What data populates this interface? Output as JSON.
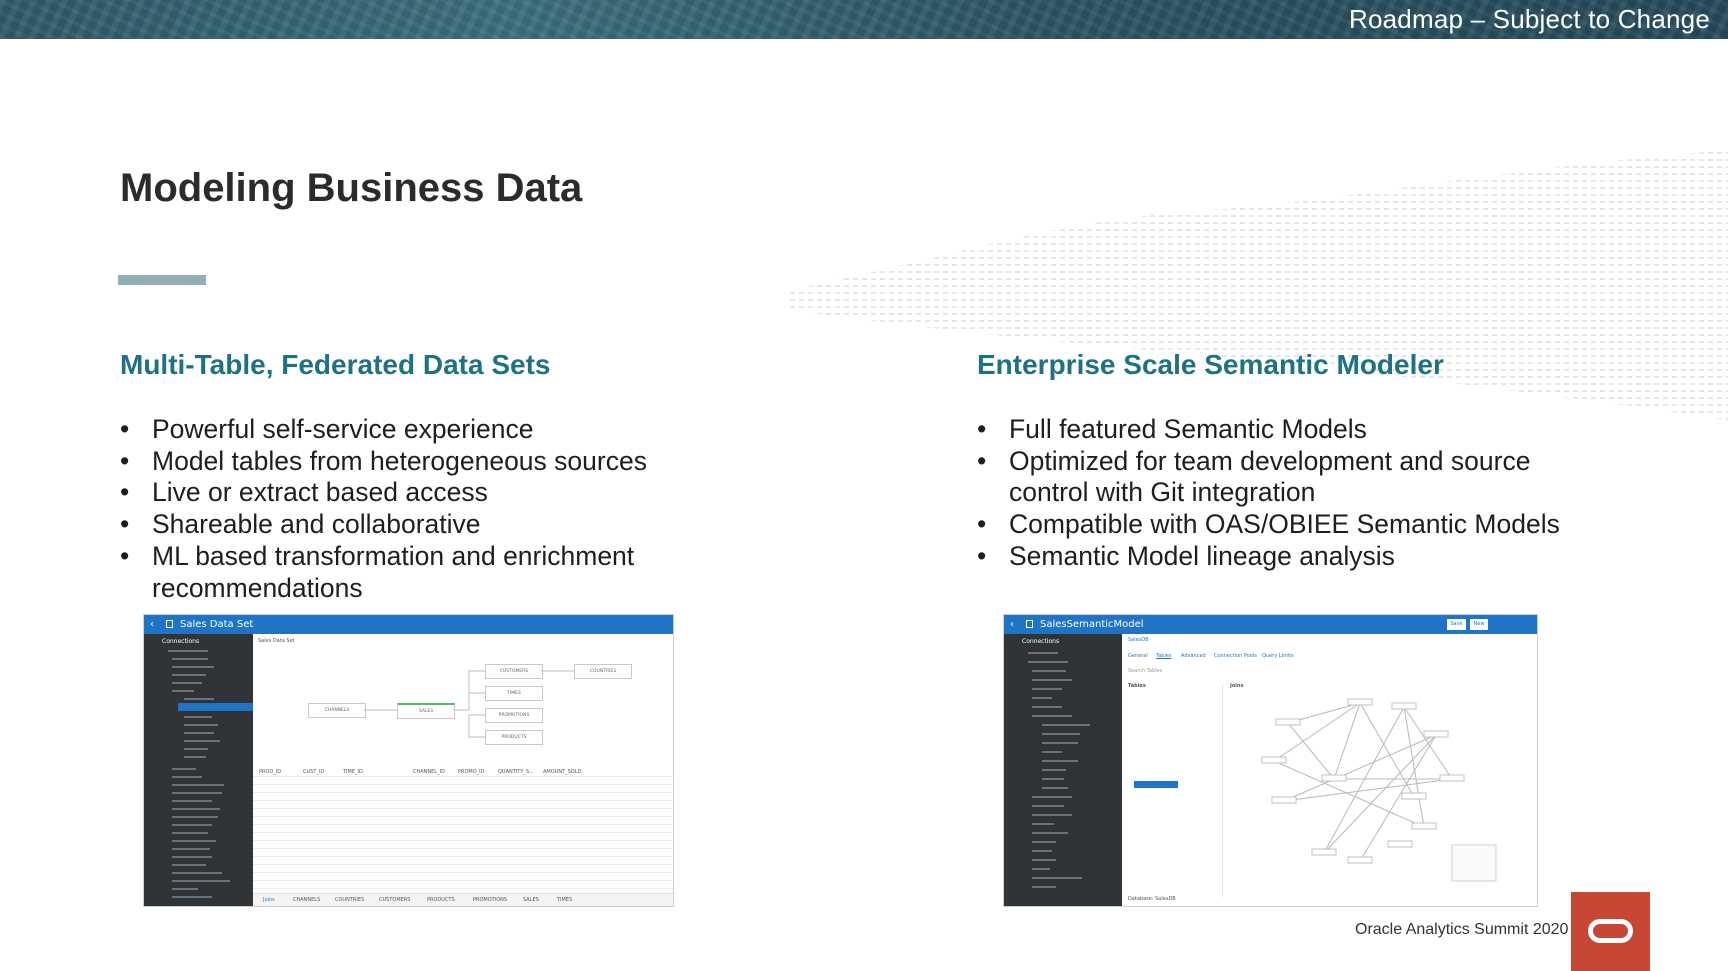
{
  "header": {
    "banner_title": "Roadmap – Subject to Change"
  },
  "page": {
    "title": "Modeling Business Data"
  },
  "left_section": {
    "heading": "Multi-Table, Federated Data Sets",
    "bullets": [
      "Powerful self-service experience",
      "Model tables from heterogeneous sources",
      "Live or extract based access",
      "Shareable and collaborative",
      "ML based transformation and enrichment recommendations"
    ],
    "screenshot": {
      "window_title": "Sales Data Set",
      "sidebar_label": "Connections",
      "canvas_title": "Sales Data Set",
      "nodes": [
        "CHANNELS",
        "SALES",
        "CUSTOMERS",
        "COUNTRIES",
        "TIMES",
        "PROMOTIONS",
        "PRODUCTS"
      ],
      "columns": [
        "PROD_ID",
        "CUST_ID",
        "TIME_ID",
        "CHANNEL_ID",
        "PROMO_ID",
        "QUANTITY_S...",
        "AMOUNT_SOLD"
      ],
      "tabs": [
        "Joins",
        "CHANNELS",
        "COUNTRIES",
        "CUSTOMERS",
        "PRODUCTS",
        "PROMOTIONS",
        "SALES",
        "TIMES"
      ]
    }
  },
  "right_section": {
    "heading": "Enterprise Scale Semantic Modeler",
    "bullets": [
      "Full featured Semantic Models",
      "Optimized for team development and source control with Git integration",
      "Compatible with OAS/OBIEE Semantic Models",
      "Semantic Model lineage analysis"
    ],
    "screenshot": {
      "window_title": "SalesSemanticModel",
      "save_label": "Save",
      "new_label": "New",
      "sidebar_label": "Connections",
      "doc_tab": "SalesDB",
      "tabs": [
        "General",
        "Tables",
        "Advanced",
        "Connection Pools",
        "Query Limits"
      ],
      "tables_label": "Tables",
      "joins_label": "Joins",
      "search_placeholder": "Search Tables",
      "footer": "Database: SalesDB"
    }
  },
  "footer": {
    "event": "Oracle Analytics Summit 2020"
  },
  "colors": {
    "accent": "#1f7280",
    "oracle_red": "#c74634",
    "app_blue": "#1f74c6"
  }
}
